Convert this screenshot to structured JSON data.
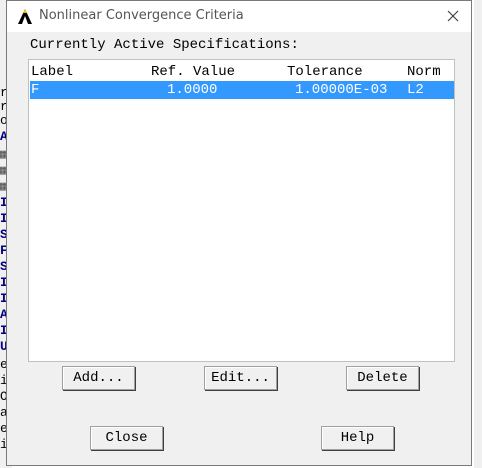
{
  "dialog": {
    "title": "Nonlinear Convergence Criteria",
    "section_label": "Currently Active Specifications:"
  },
  "list": {
    "columns": [
      "Label",
      "Ref. Value",
      "Tolerance",
      "Norm"
    ],
    "rows": [
      {
        "label": "F",
        "ref_value": "1.0000",
        "tolerance": "1.00000E-03",
        "norm": "L2",
        "selected": true
      }
    ]
  },
  "buttons": {
    "add": "Add...",
    "edit": "Edit...",
    "delete": "Delete",
    "close": "Close",
    "help": "Help"
  },
  "background_fragments": [
    "re",
    "re",
    "oi",
    "A",
    "▦",
    "▦",
    "▦",
    "I",
    "I",
    "S",
    "F",
    "S",
    "I",
    "I",
    "A",
    "I",
    "U",
    "er",
    "ir",
    "Ol",
    "ac",
    "es",
    "ir"
  ],
  "colors": {
    "selection": "#3399ff",
    "dialog_bg": "#f0f0f0",
    "bg_text": "#000080"
  },
  "icons": {
    "app": "ansys-logo-icon",
    "close": "close-icon"
  }
}
